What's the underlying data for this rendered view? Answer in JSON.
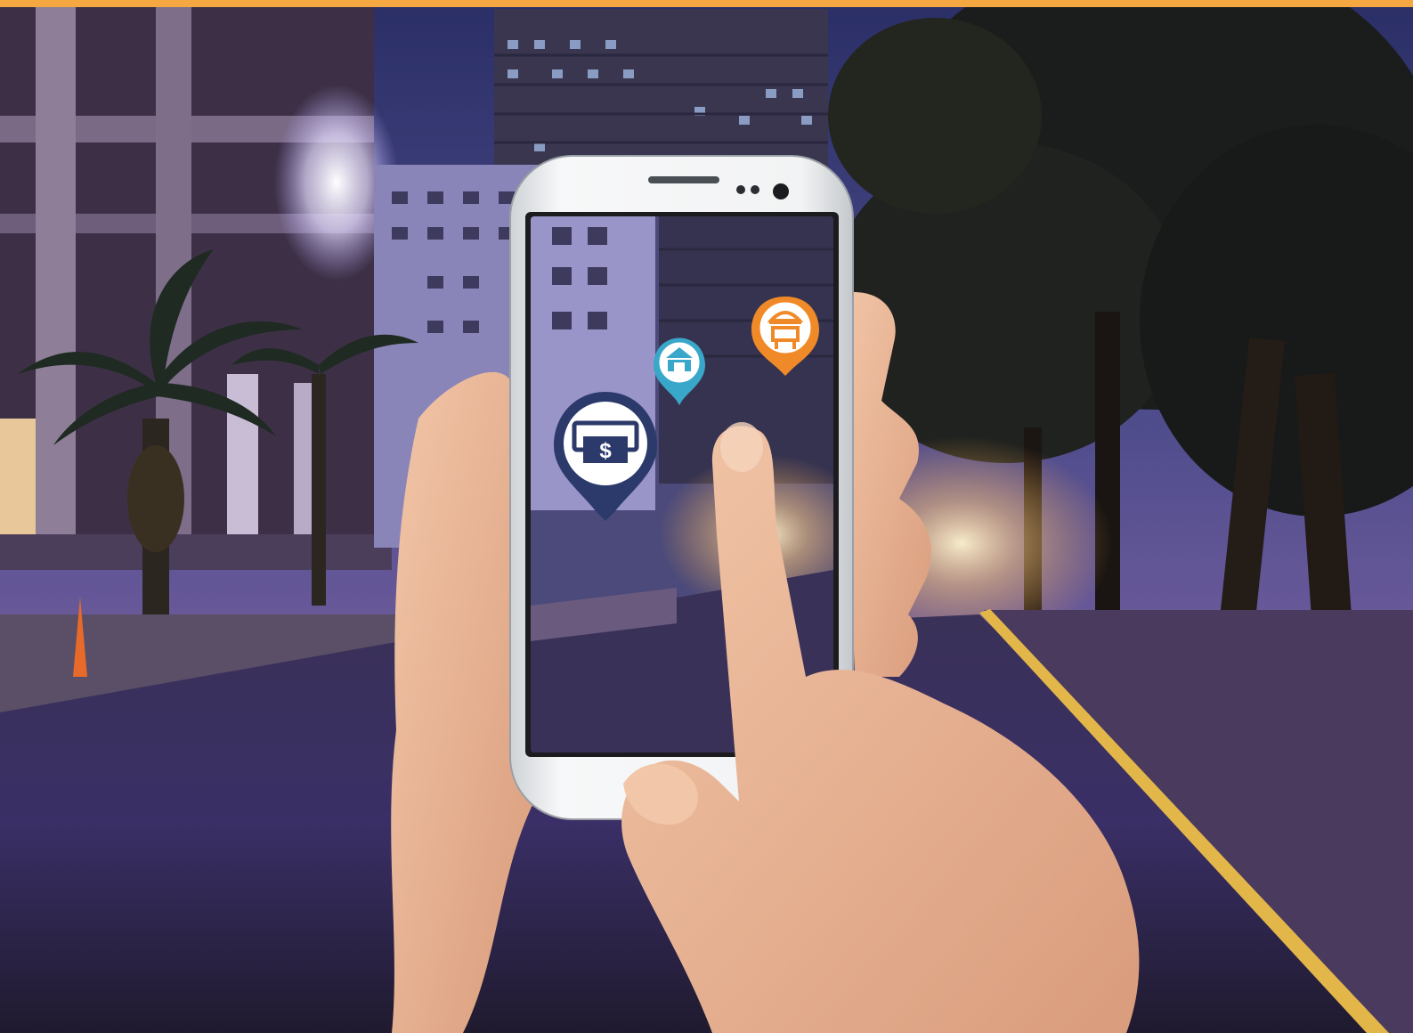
{
  "scene": {
    "top_bar_color": "#f5a742",
    "sky_color": "#2f3470",
    "road_color": "#2a2440",
    "road_tint": "#5a3f9a",
    "curb_line_color": "#e3b64a"
  },
  "phone": {
    "body_color": "#eceeef",
    "screen_bezel_color": "#1c1c1f"
  },
  "ar_markers": [
    {
      "name": "atm-marker",
      "icon": "atm-dollar-icon",
      "symbol": "$",
      "accent": "#2c3a6b",
      "fill": "#ffffff"
    },
    {
      "name": "bank-marker",
      "icon": "bank-building-icon",
      "accent": "#39a7c9",
      "fill": "#ffffff"
    },
    {
      "name": "restaurant-marker",
      "icon": "food-tray-icon",
      "accent": "#f08a28",
      "fill": "#ffffff"
    }
  ]
}
